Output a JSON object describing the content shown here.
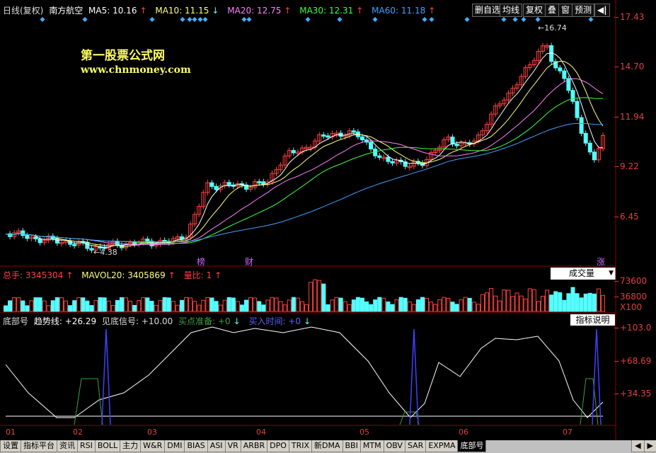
{
  "main_header": {
    "period": "日线(复权)",
    "stock": "南方航空",
    "ma5": "MA5: 10.16",
    "ma10": "MA10: 11.15",
    "ma20": "MA20: 12.75",
    "ma30": "MA30: 12.31",
    "ma60": "MA60: 11.18",
    "up_arrow": "↑",
    "down_arrow": "↓"
  },
  "toolbar": [
    "删自选",
    "均线",
    "复权",
    "叠",
    "窗",
    "预测"
  ],
  "toolbar_nav_icon": "◀|",
  "price_axis": [
    "17.43",
    "14.70",
    "11.94",
    "9.22",
    "6.45"
  ],
  "watermark": {
    "line1": "第一股票公式网",
    "line2": "www.chnmoney.com"
  },
  "annotations": {
    "high": "16.74",
    "low": "4.38",
    "mark1": "榜",
    "mark2": "财",
    "mark3": "涨"
  },
  "volume_header": {
    "total": "总手: 3345304",
    "mavol": "MAVOL20: 3405869",
    "ratio": "量比: 1",
    "selector": "成交量",
    "axis_top": "73600",
    "axis_mid": "36800",
    "axis_unit": "X100"
  },
  "indicator_header": {
    "name": "底部号",
    "trend": "趋势线: +26.29",
    "signal": "见底信号: +10.00",
    "prepare": "买点准备: +0",
    "time": "买入时间: +0",
    "help": "指标说明",
    "axis": [
      "+103.0",
      "+68.69",
      "+34.35"
    ]
  },
  "months": [
    "01",
    "02",
    "03",
    "04",
    "05",
    "06",
    "07"
  ],
  "tabs": [
    "设置",
    "指标平台",
    "资讯",
    "RSI",
    "BOLL",
    "主力",
    "W&R",
    "DMI",
    "BIAS",
    "ASI",
    "VR",
    "ARBR",
    "DPO",
    "TRIX",
    "新DMA",
    "BBI",
    "MTM",
    "OBV",
    "SAR",
    "EXPMA",
    "底部号"
  ],
  "colors": {
    "up": "#ff4040",
    "down": "#54ffff",
    "ma5": "#ffffff",
    "ma10": "#ffff80",
    "ma20": "#ff80ff",
    "ma30": "#40ff40",
    "ma60": "#40a0ff",
    "signal": "#4040ff",
    "prepare": "#40a040"
  }
}
